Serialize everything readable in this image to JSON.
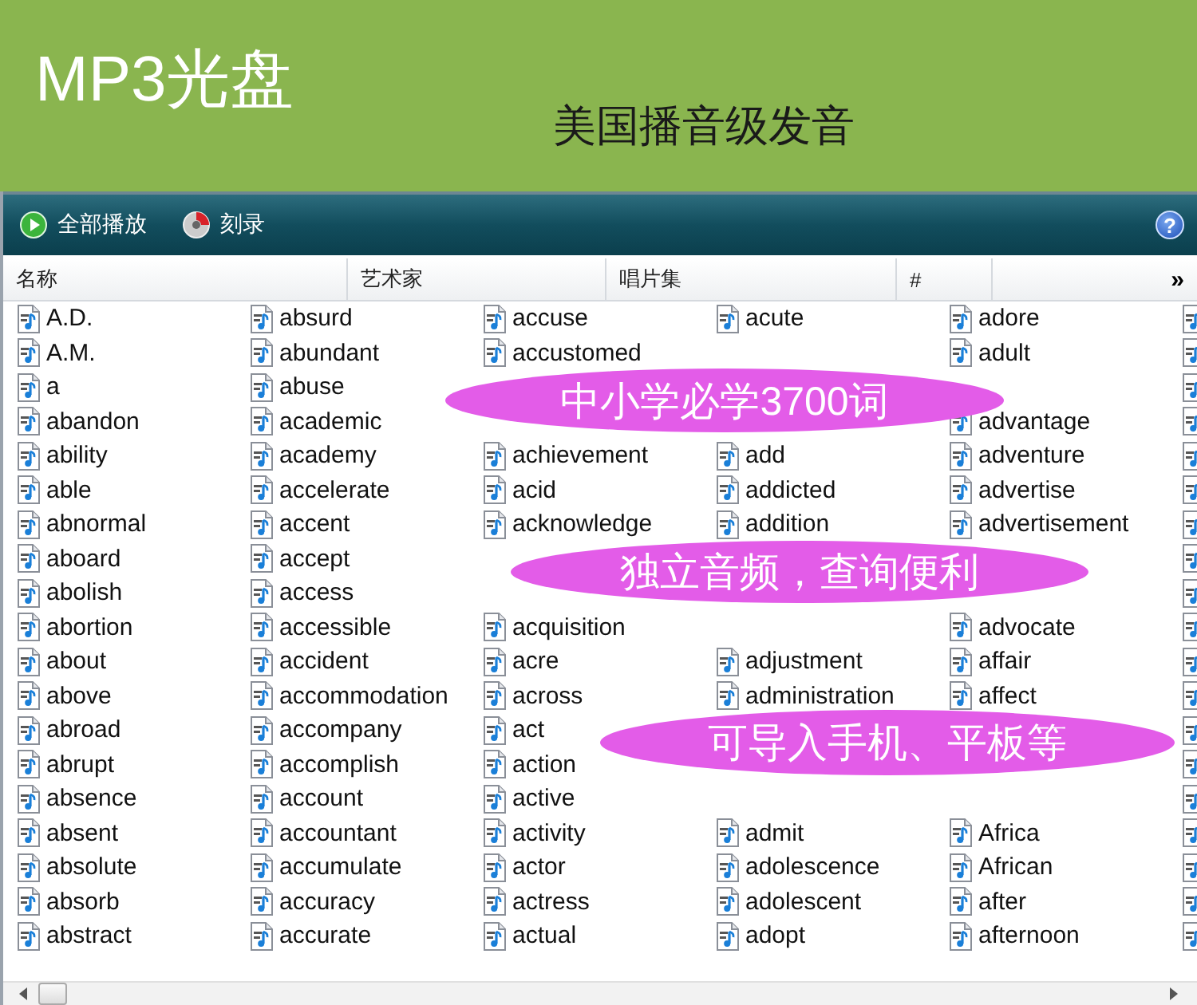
{
  "banner": {
    "title": "MP3光盘",
    "subtitle": "美国播音级发音"
  },
  "toolbar": {
    "buttons": [
      {
        "kind": "play",
        "label": "全部播放"
      },
      {
        "kind": "burn",
        "label": "刻录"
      }
    ],
    "help": "?"
  },
  "columns": [
    "名称",
    "艺术家",
    "唱片集",
    "#"
  ],
  "more": "»",
  "word_columns": [
    [
      "A.D.",
      "A.M.",
      "a",
      "abandon",
      "ability",
      "able",
      "abnormal",
      "aboard",
      "abolish",
      "abortion",
      "about",
      "above",
      "abroad",
      "abrupt",
      "absence",
      "absent",
      "absolute",
      "absorb",
      "abstract"
    ],
    [
      "absurd",
      "abundant",
      "abuse",
      "academic",
      "academy",
      "accelerate",
      "accent",
      "accept",
      "access",
      "accessible",
      "accident",
      "accommodation",
      "accompany",
      "accomplish",
      "account",
      "accountant",
      "accumulate",
      "accuracy",
      "accurate"
    ],
    [
      "accuse",
      "accustomed",
      null,
      null,
      "achievement",
      "acid",
      "acknowledge",
      null,
      null,
      "acquisition",
      "acre",
      "across",
      "act",
      "action",
      "active",
      "activity",
      "actor",
      "actress",
      "actual"
    ],
    [
      "acute",
      null,
      null,
      null,
      "add",
      "addicted",
      "addition",
      null,
      null,
      null,
      "adjustment",
      "administration",
      null,
      null,
      null,
      "admit",
      "adolescence",
      "adolescent",
      "adopt"
    ],
    [
      "adore",
      "adult",
      null,
      "advantage",
      "adventure",
      "advertise",
      "advertisement",
      null,
      null,
      "advocate",
      "affair",
      "affect",
      null,
      null,
      null,
      "Africa",
      "African",
      "after",
      "afternoon"
    ]
  ],
  "callouts": [
    "中小学必学3700词",
    "独立音频，查询便利",
    "可导入手机、平板等"
  ]
}
